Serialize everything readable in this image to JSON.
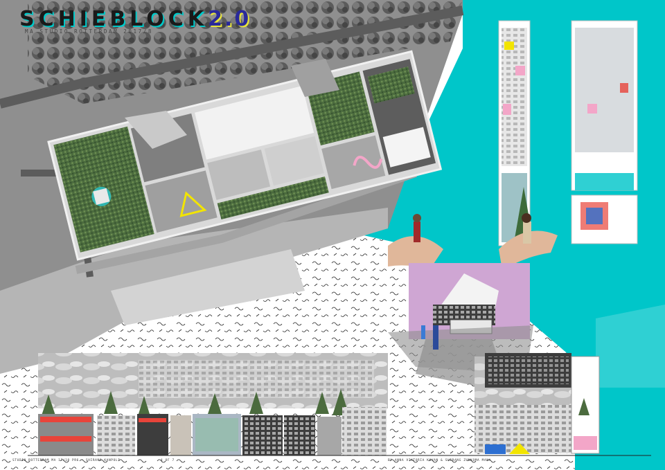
{
  "poster": {
    "title_main": "SCHIEBLOCK",
    "title_version": "2.0",
    "subtitle": "MA STUDIO ROTTERDAM 2017/8"
  },
  "palette": {
    "accent_teal": "#00c6c9",
    "map_grey": "#8f8f8f",
    "greenery": "#3f6b3a",
    "highlight_yellow": "#f2e400",
    "pink": "#f3a6c8",
    "facade_red": "#e8443a"
  },
  "footer": {
    "left_note": "STUDIO ROTTERDAM MA 17/18 PR6 - SHIRANG KANPOLI",
    "page_number": "4 OF 7",
    "right_note": "BY ANNA VIKTORIA KOVAN & SHIRANG ZUNKOMA MANA"
  }
}
